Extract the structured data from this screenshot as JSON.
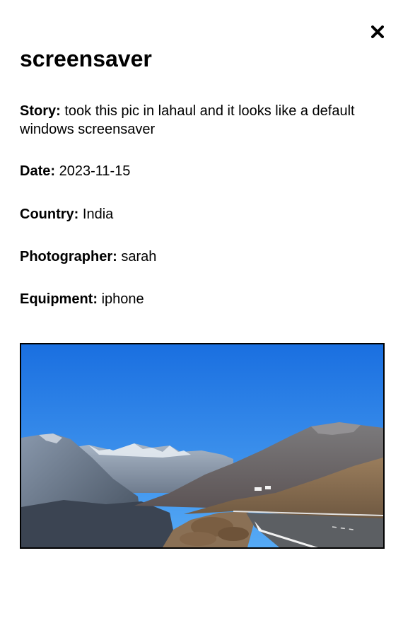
{
  "modal": {
    "title": "screensaver",
    "close_icon": "close-icon",
    "fields": {
      "story": {
        "label": "Story:",
        "value": "took this pic in lahaul and it looks like a default windows screensaver"
      },
      "date": {
        "label": "Date:",
        "value": "2023-11-15"
      },
      "country": {
        "label": "Country:",
        "value": "India"
      },
      "photographer": {
        "label": "Photographer:",
        "value": "sarah"
      },
      "equipment": {
        "label": "Equipment:",
        "value": "iphone"
      }
    },
    "photo": {
      "subject": "mountain road under blue sky",
      "colors": {
        "sky_top": "#1a6fe0",
        "sky_bottom": "#56aaf5",
        "mountain_far": "#8b98aa",
        "snow": "#e9eef4",
        "mountain_mid": "#6b6a6c",
        "slope_brown": "#8a6f52",
        "road": "#5c5f63",
        "road_line": "#f2f2f2"
      }
    }
  }
}
